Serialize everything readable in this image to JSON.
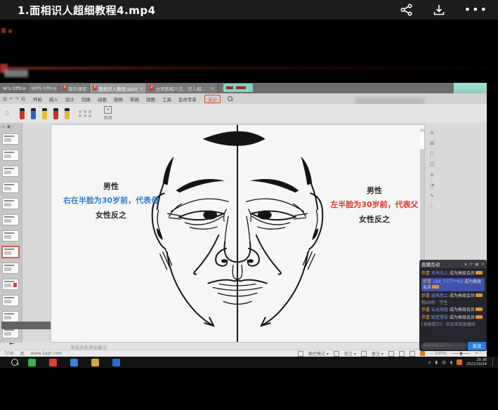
{
  "player": {
    "title": "1.面相识人超细教程4.mp4"
  },
  "wps": {
    "window_tabs": [
      {
        "label": "WPS Office",
        "active": false
      },
      {
        "label": "我的课程",
        "active": false
      },
      {
        "label": "面相识人教程.pptx",
        "active": true
      },
      {
        "label": "占测面相八法，识人相面，轻松…",
        "active": false
      }
    ],
    "new_tab_label": "+",
    "menu": [
      "开始",
      "插入",
      "设计",
      "切换",
      "动画",
      "放映",
      "审阅",
      "视图",
      "工具",
      "会员专享"
    ],
    "menu_highlight": "演示",
    "close_label": "关闭",
    "pen_colors": [
      "#c8372a",
      "#2f63c8",
      "#e3c02f",
      "#bf3328",
      "#d9b843"
    ],
    "right_tool_icons": [
      "outline-icon",
      "notes-icon",
      "layout-icon",
      "animation-icon",
      "text-tool-icon",
      "clock-icon",
      "edit-icon",
      "more-icon"
    ],
    "slide_panel": {
      "thumb_count": 13,
      "selected_index": 7
    }
  },
  "slide": {
    "left_note": {
      "gender": "男性",
      "rule": "右在半脸为30岁前，代表母",
      "reverse": "女性反之",
      "rule_color": "#2b7fd0"
    },
    "right_note": {
      "gender": "男性",
      "rule": "左半脸为30岁前，代表父",
      "reverse": "女性反之",
      "rule_color": "#df3526"
    }
  },
  "chat": {
    "title": "直播互动",
    "messages": [
      {
        "style": "congrats",
        "prefix": "恭喜",
        "name": "天天向上",
        "text": "成为高级会员"
      },
      {
        "style": "congrats-highlight",
        "prefix": "恭喜",
        "name": "188_7577**89",
        "text": "成为高级会员"
      },
      {
        "style": "congrats",
        "prefix": "恭喜",
        "name": "迎风而上",
        "text": "成为高级会员"
      },
      {
        "style": "plain",
        "name": "梅sR彤",
        "text": "学生"
      },
      {
        "style": "congrats",
        "prefix": "恭喜",
        "name": "云淡风轻",
        "text": "成为高级会员"
      },
      {
        "style": "congrats",
        "prefix": "恭喜",
        "name": "知足常乐",
        "text": "成为高级会员"
      },
      {
        "style": "plain",
        "name": "[系统提示]",
        "text": "欢迎来到直播间"
      }
    ],
    "input_placeholder": "和老师说点什么~",
    "send_label": "发送"
  },
  "notes_hint": "单击此处添加备注",
  "statusbar": {
    "page": "7/16",
    "lang": "英",
    "site": "www.1ppt.com",
    "right_items": [
      "触控模式",
      "批注",
      "备注"
    ],
    "zoom": "100%"
  },
  "taskbar": {
    "apps": [
      {
        "name": "wechat-icon",
        "color": "#3cb347"
      },
      {
        "name": "stocks-app-icon",
        "color": "#d84231"
      },
      {
        "name": "qq-icon",
        "color": "#3e82d8"
      },
      {
        "name": "file-explorer-icon",
        "color": "#d9a33c"
      },
      {
        "name": "video-app-icon",
        "color": "#3168d8"
      }
    ],
    "time": "20:36",
    "date": "2021/10/24"
  }
}
